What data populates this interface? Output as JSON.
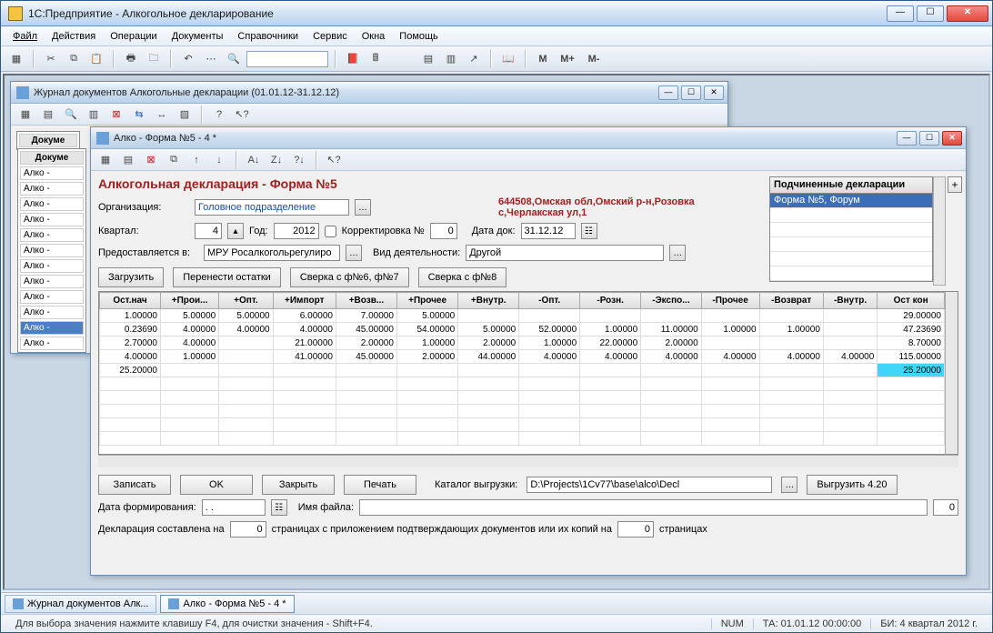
{
  "app": {
    "title": "1С:Предприятие - Алкогольное декларирование"
  },
  "menu": {
    "file": "Файл",
    "actions": "Действия",
    "operations": "Операции",
    "documents": "Документы",
    "refs": "Справочники",
    "service": "Сервис",
    "windows": "Окна",
    "help": "Помощь"
  },
  "toolbar_text": {
    "m": "M",
    "mplus": "M+",
    "mminus": "M-"
  },
  "journal": {
    "title": "Журнал документов  Алкогольные декларации (01.01.12-31.12.12)",
    "col_doc": "Докуме",
    "rows": [
      "Алко -",
      "Алко -",
      "Алко -",
      "Алко -",
      "Алко -",
      "Алко -",
      "Алко -",
      "Алко -",
      "Алко -",
      "Алко -",
      "Алко -",
      "Алко -"
    ]
  },
  "form": {
    "title": "Алко - Форма №5 - 4 *",
    "heading": "Алкогольная декларация -   Форма №5",
    "org_label": "Организация:",
    "org_value": "Головное подразделение",
    "address_line1": "644508,Омская обл,Омский р-н,Розовка",
    "address_line2": "с,Черлакская ул,1",
    "quarter_label": "Квартал:",
    "quarter_value": "4",
    "year_label": "Год:",
    "year_value": "2012",
    "correction_label": "Корректировка №",
    "correction_value": "0",
    "date_doc_label": "Дата док:",
    "date_doc_value": "31.12.12",
    "provided_label": "Предоставляется в:",
    "provided_value": "МРУ Росалкогольрегулиро",
    "activity_label": "Вид деятельности:",
    "activity_value": "Другой",
    "sub_header": "Подчиненные декларации",
    "sub_item": "Форма №5, Форум",
    "btn_load": "Загрузить",
    "btn_transfer": "Перенести остатки",
    "btn_check67": "Сверка с ф№6, ф№7",
    "btn_check8": "Сверка с ф№8",
    "columns": [
      "Ост.нач",
      "+Прои...",
      "+Опт.",
      "+Импорт",
      "+Возв...",
      "+Прочее",
      "+Внутр.",
      "-Опт.",
      "-Розн.",
      "-Экспо...",
      "-Прочее",
      "-Возврат",
      "-Внутр.",
      "Ост кон"
    ],
    "rows": [
      [
        "1.00000",
        "5.00000",
        "5.00000",
        "6.00000",
        "7.00000",
        "5.00000",
        "",
        "",
        "",
        "",
        "",
        "",
        "",
        "29.00000"
      ],
      [
        "0.23690",
        "4.00000",
        "4.00000",
        "4.00000",
        "45.00000",
        "54.00000",
        "5.00000",
        "52.00000",
        "1.00000",
        "11.00000",
        "1.00000",
        "1.00000",
        "",
        "47.23690"
      ],
      [
        "2.70000",
        "4.00000",
        "",
        "21.00000",
        "2.00000",
        "1.00000",
        "2.00000",
        "1.00000",
        "22.00000",
        "2.00000",
        "",
        "",
        "",
        "8.70000"
      ],
      [
        "4.00000",
        "1.00000",
        "",
        "41.00000",
        "45.00000",
        "2.00000",
        "44.00000",
        "4.00000",
        "4.00000",
        "4.00000",
        "4.00000",
        "4.00000",
        "4.00000",
        "115.00000"
      ],
      [
        "25.20000",
        "",
        "",
        "",
        "",
        "",
        "",
        "",
        "",
        "",
        "",
        "",
        "",
        "25.20000"
      ]
    ],
    "btn_write": "Записать",
    "btn_ok": "OK",
    "btn_close": "Закрыть",
    "btn_print": "Печать",
    "upload_dir_label": "Каталог выгрузки:",
    "upload_dir_value": "D:\\Projects\\1Cv77\\base\\alco\\Decl",
    "btn_upload": "Выгрузить 4.20",
    "form_date_label": "Дата формирования:",
    "form_date_value": " .  .  ",
    "filename_label": "Имя файла:",
    "filename_value": "",
    "file_count": "0",
    "decl_compiled_1": "Декларация составлена на",
    "decl_pages1": "0",
    "decl_compiled_2": "страницах с приложением подтверждающих документов или их копий на",
    "decl_pages2": "0",
    "decl_compiled_3": "страницах"
  },
  "taskbar": {
    "t1": "Журнал документов  Алк...",
    "t2": "Алко - Форма №5 - 4 *"
  },
  "status": {
    "hint": "Для выбора значения нажмите клавишу F4, для очистки значения - Shift+F4.",
    "num": "NUM",
    "ta": "ТА: 01.01.12  00:00:00",
    "bi": "БИ: 4 квартал 2012 г."
  }
}
